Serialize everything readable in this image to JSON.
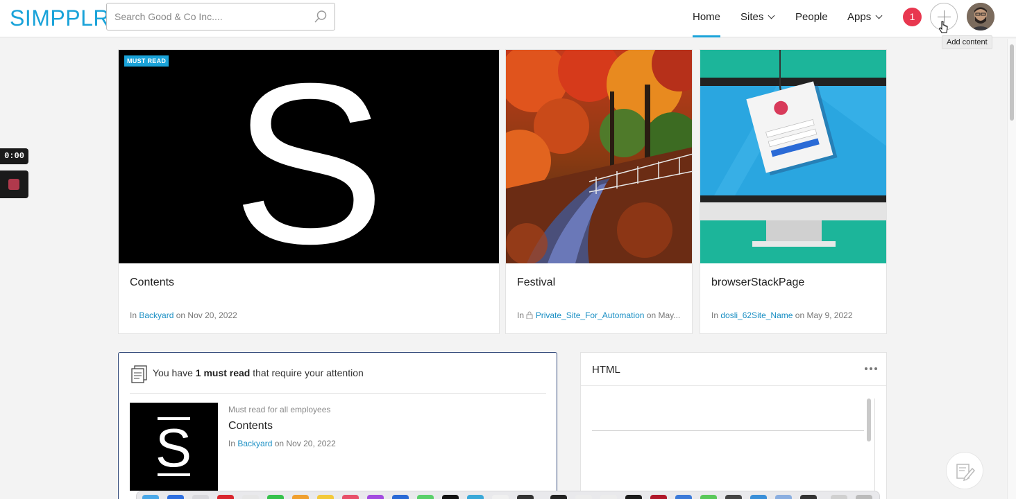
{
  "header": {
    "logo": "SIMPPLR",
    "search_placeholder": "Search Good & Co Inc....",
    "nav": {
      "home": "Home",
      "sites": "Sites",
      "people": "People",
      "apps": "Apps"
    },
    "notifications_count": "1",
    "add_content_tooltip": "Add content"
  },
  "overlay": {
    "timer": "0:00"
  },
  "featured": [
    {
      "badge": "MUST READ",
      "title": "Contents",
      "in": "In",
      "site": "Backyard",
      "date": "on Nov 20, 2022"
    },
    {
      "title": "Festival",
      "in": "In",
      "site": "Private_Site_For_Automation",
      "date": "on May..."
    },
    {
      "title": "browserStackPage",
      "in": "In",
      "site": "dosli_62Site_Name",
      "date": "on May 9, 2022"
    }
  ],
  "must_read": {
    "text_prefix": "You have ",
    "count": "1 must read",
    "text_suffix": " that require your attention",
    "item_label": "Must read for all employees",
    "item_title": "Contents",
    "in": "In",
    "item_site": "Backyard",
    "item_date": "on Nov 20, 2022"
  },
  "html_widget": {
    "title": "HTML"
  },
  "colors": {
    "accent": "#1aa3d9",
    "link": "#1a8fc4",
    "badge_red": "#e8374f"
  }
}
